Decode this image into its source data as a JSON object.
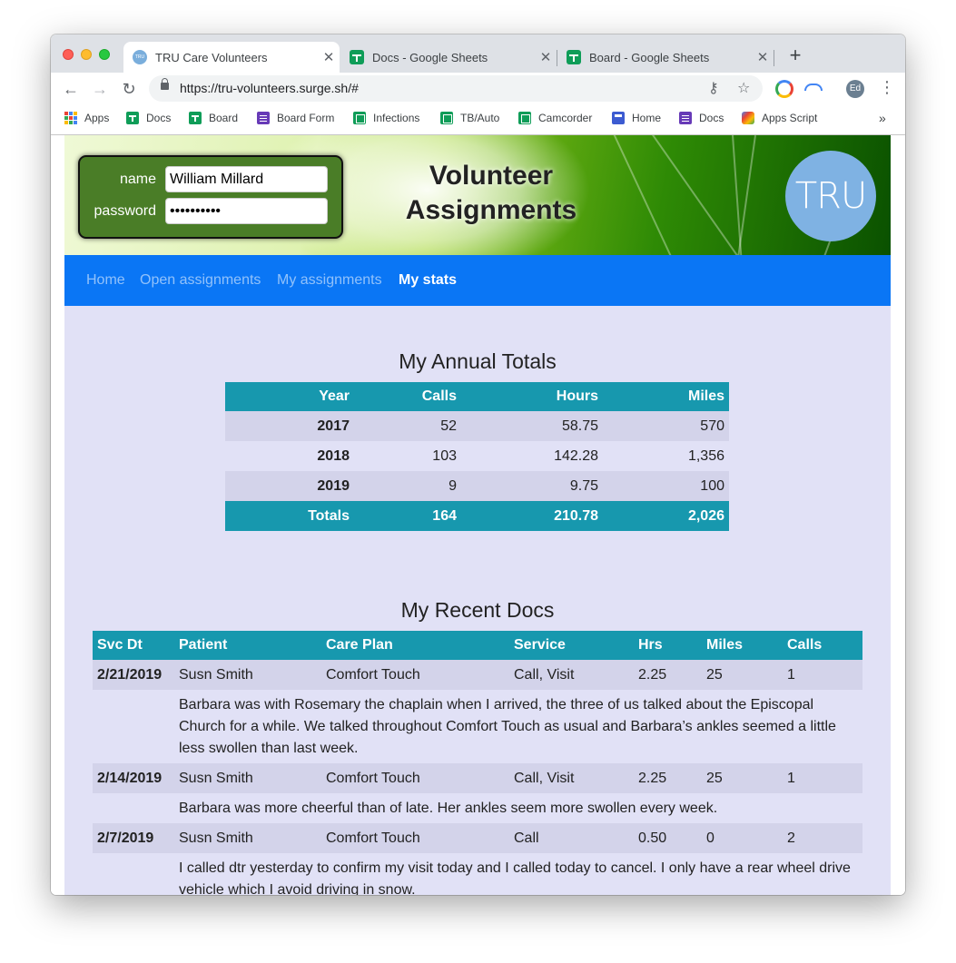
{
  "browser": {
    "tabs": [
      {
        "title": "TRU Care Volunteers",
        "favicon": "tru-icon",
        "close": "✕"
      },
      {
        "title": "Docs - Google Sheets",
        "favicon": "sheets-icon",
        "close": "✕"
      },
      {
        "title": "Board - Google Sheets",
        "favicon": "sheets-icon",
        "close": "✕"
      }
    ],
    "new_tab": "+",
    "url": "https://tru-volunteers.surge.sh/#",
    "avatar": "Ed",
    "bookmarks": [
      {
        "label": "Apps",
        "icon": "apps-grid-icon"
      },
      {
        "label": "Docs",
        "icon": "sheets-icon"
      },
      {
        "label": "Board",
        "icon": "sheets-icon"
      },
      {
        "label": "Board Form",
        "icon": "forms-icon"
      },
      {
        "label": "Infections",
        "icon": "sheets-icon"
      },
      {
        "label": "TB/Auto",
        "icon": "sheets-icon"
      },
      {
        "label": "Camcorder",
        "icon": "sheets-icon"
      },
      {
        "label": "Home",
        "icon": "sites-icon"
      },
      {
        "label": "Docs",
        "icon": "forms-icon"
      },
      {
        "label": "Apps Script",
        "icon": "apps-script-icon"
      }
    ],
    "bookmarks_more": "»"
  },
  "login": {
    "name_label": "name",
    "name_value": "William Millard",
    "password_label": "password",
    "password_value": "••••••••••"
  },
  "header": {
    "title_line1": "Volunteer",
    "title_line2": "Assignments",
    "logo_text": "TRU"
  },
  "nav": [
    {
      "label": "Home",
      "active": false
    },
    {
      "label": "Open assignments",
      "active": false
    },
    {
      "label": "My assignments",
      "active": false
    },
    {
      "label": "My stats",
      "active": true
    }
  ],
  "annual_totals": {
    "title": "My Annual Totals",
    "columns": [
      "Year",
      "Calls",
      "Hours",
      "Miles"
    ],
    "rows": [
      [
        "2017",
        "52",
        "58.75",
        "570"
      ],
      [
        "2018",
        "103",
        "142.28",
        "1,356"
      ],
      [
        "2019",
        "9",
        "9.75",
        "100"
      ]
    ],
    "totals": [
      "Totals",
      "164",
      "210.78",
      "2,026"
    ]
  },
  "recent_docs": {
    "title": "My Recent Docs",
    "columns": [
      "Svc Dt",
      "Patient",
      "Care Plan",
      "Service",
      "Hrs",
      "Miles",
      "Calls"
    ],
    "records": [
      {
        "cells": [
          "2/21/2019",
          "Susn Smith",
          "Comfort Touch",
          "Call, Visit",
          "2.25",
          "25",
          "1"
        ],
        "note": "Barbara was with Rosemary the chaplain when I arrived, the three of us talked about the Episcopal Church for a while. We talked throughout Comfort Touch as usual and Barbara’s ankles seemed a little less swollen than last week."
      },
      {
        "cells": [
          "2/14/2019",
          "Susn Smith",
          "Comfort Touch",
          "Call, Visit",
          "2.25",
          "25",
          "1"
        ],
        "note": "Barbara was more cheerful than of late. Her ankles seem more swollen every week."
      },
      {
        "cells": [
          "2/7/2019",
          "Susn Smith",
          "Comfort Touch",
          "Call",
          "0.50",
          "0",
          "2"
        ],
        "note": "I called dtr yesterday to confirm my visit today and I called today to cancel. I only have a rear wheel drive vehicle which I avoid driving in snow."
      }
    ]
  },
  "colors": {
    "nav_bg": "#0a76f5",
    "table_header": "#1798ae",
    "row_shade": "#d3d3ea",
    "page_bg": "#e1e1f6"
  }
}
